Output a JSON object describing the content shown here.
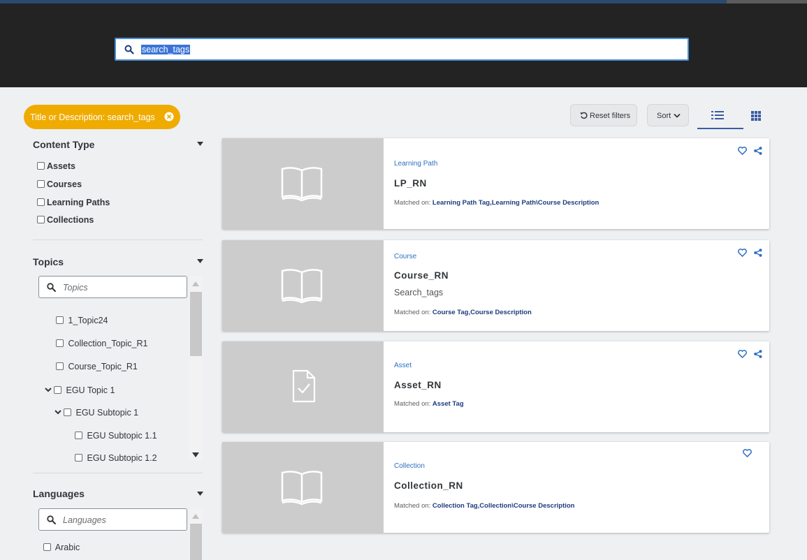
{
  "search": {
    "value": "search_tags"
  },
  "filter_chip": {
    "label": "Title or Description: search_tags"
  },
  "toolbar": {
    "reset_label": "Reset filters",
    "sort_label": "Sort"
  },
  "sidebar": {
    "content_type": {
      "title": "Content Type",
      "items": [
        "Assets",
        "Courses",
        "Learning Paths",
        "Collections"
      ]
    },
    "topics": {
      "title": "Topics",
      "placeholder": "Topics",
      "items": [
        "1_Topic24",
        "Collection_Topic_R1",
        "Course_Topic_R1",
        "EGU Topic 1",
        "EGU Subtopic 1",
        "EGU Subtopic 1.1",
        "EGU Subtopic 1.2"
      ]
    },
    "languages": {
      "title": "Languages",
      "placeholder": "Languages",
      "items": [
        "Arabic"
      ]
    }
  },
  "results": [
    {
      "type": "Learning Path",
      "title": "LP_RN",
      "description": "",
      "matched_prefix": "Matched on: ",
      "matched_on": "Learning Path Tag,Learning Path\\Course Description",
      "icon": "book-icon",
      "share": true
    },
    {
      "type": "Course",
      "title": "Course_RN",
      "description": "Search_tags",
      "matched_prefix": "Matched on: ",
      "matched_on": "Course Tag,Course Description",
      "icon": "book-icon",
      "share": true
    },
    {
      "type": "Asset",
      "title": "Asset_RN",
      "description": "",
      "matched_prefix": "Matched on: ",
      "matched_on": "Asset Tag",
      "icon": "document-check-icon",
      "share": true
    },
    {
      "type": "Collection",
      "title": "Collection_RN",
      "description": "",
      "matched_prefix": "Matched on: ",
      "matched_on": "Collection Tag,Collection\\Course Description",
      "icon": "book-icon",
      "share": false
    }
  ],
  "colors": {
    "accent": "#f0ab00",
    "link": "#2b6fc2",
    "header_bg": "#232323",
    "thumb_bg": "#cccccc"
  }
}
